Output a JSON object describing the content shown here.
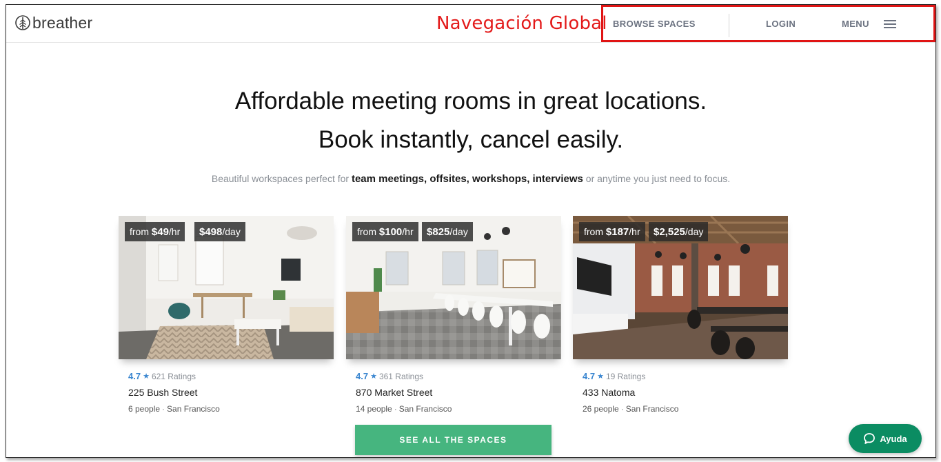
{
  "brand": {
    "name": "breather",
    "logo_icon": "tree-leaf-icon"
  },
  "annotation": {
    "label": "Navegación Global",
    "color": "#e31919"
  },
  "nav": {
    "browse": "BROWSE SPACES",
    "login": "LOGIN",
    "menu": "MENU",
    "menu_icon": "hamburger-icon"
  },
  "hero": {
    "line1": "Affordable meeting rooms in great locations.",
    "line2": "Book instantly, cancel easily.",
    "sub_prefix": "Beautiful workspaces perfect for ",
    "sub_bold": "team meetings, offsites, workshops, interviews",
    "sub_suffix": " or anytime you just need to focus."
  },
  "spaces": [
    {
      "hour_prefix": "from ",
      "hour_price": "$49",
      "hour_unit": "/hr",
      "day_price": "$498",
      "day_unit": "/day",
      "rating": "4.7",
      "ratings_count": "621 Ratings",
      "title": "225 Bush Street",
      "people": "6 people",
      "city": "San Francisco"
    },
    {
      "hour_prefix": "from ",
      "hour_price": "$100",
      "hour_unit": "/hr",
      "day_price": "$825",
      "day_unit": "/day",
      "rating": "4.7",
      "ratings_count": "361 Ratings",
      "title": "870 Market Street",
      "people": "14 people",
      "city": "San Francisco"
    },
    {
      "hour_prefix": "from ",
      "hour_price": "$187",
      "hour_unit": "/hr",
      "day_price": "$2,525",
      "day_unit": "/day",
      "rating": "4.7",
      "ratings_count": "19 Ratings",
      "title": "433 Natoma",
      "people": "26 people",
      "city": "San Francisco"
    }
  ],
  "cta": {
    "label": "SEE ALL THE SPACES",
    "color": "#46b57f"
  },
  "help": {
    "label": "Ayuda",
    "icon": "chat-bubble-icon",
    "color": "#0b8c62"
  },
  "star_glyph": "★",
  "separator": "·"
}
